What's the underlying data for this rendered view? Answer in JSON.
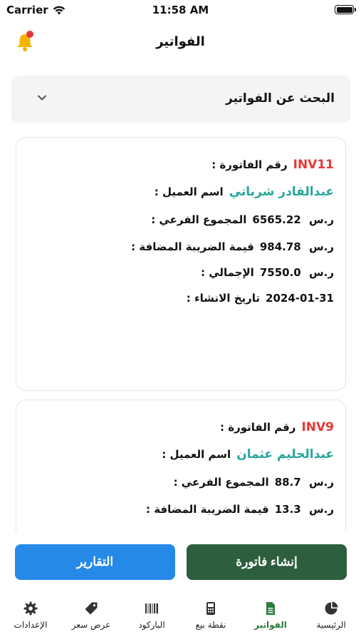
{
  "status_bar": {
    "carrier": "Carrier",
    "time": "11:58 AM"
  },
  "header": {
    "title": "الفواتير"
  },
  "search": {
    "label": "البحث عن الفواتير"
  },
  "invoices": [
    {
      "number_label": "رقم الفاتورة :",
      "number": "INV11",
      "client_label": "اسم العميل :",
      "client": "عبدالقادر شرباتي",
      "subtotal_label": "المجموع الفرعي :",
      "subtotal": "6565.22",
      "tax_label": "قيمة الضريبة المضافة :",
      "tax": "984.78",
      "total_label": "الإجمالي :",
      "total": "7550.0",
      "date_label": "تاريخ الانشاء :",
      "date": "2024-01-31",
      "currency": "ر.س"
    },
    {
      "number_label": "رقم الفاتورة :",
      "number": "INV9",
      "client_label": "اسم العميل :",
      "client": "عبدالحليم عثمان",
      "subtotal_label": "المجموع الفرعي :",
      "subtotal": "88.7",
      "tax_label": "قيمة الضريبة المضافة :",
      "tax": "13.3",
      "currency": "ر.س"
    }
  ],
  "buttons": {
    "create": "إنشاء فاتورة",
    "reports": "التقارير"
  },
  "tabs": [
    {
      "label": "الرئيسية",
      "icon": "pie-chart-icon"
    },
    {
      "label": "الفواتير",
      "icon": "invoice-icon",
      "active": true
    },
    {
      "label": "نقطة بيع",
      "icon": "pos-icon"
    },
    {
      "label": "الباركود",
      "icon": "barcode-icon"
    },
    {
      "label": "عرض سعر",
      "icon": "price-tag-icon"
    },
    {
      "label": "الإعدادات",
      "icon": "gear-icon"
    }
  ],
  "colors": {
    "invoice_number": "#e53935",
    "client_name": "#26a69a",
    "create_button": "#2d5e3e",
    "reports_button": "#2589e8",
    "active_tab": "#2d7a3e",
    "notification_dot": "#e53935"
  }
}
